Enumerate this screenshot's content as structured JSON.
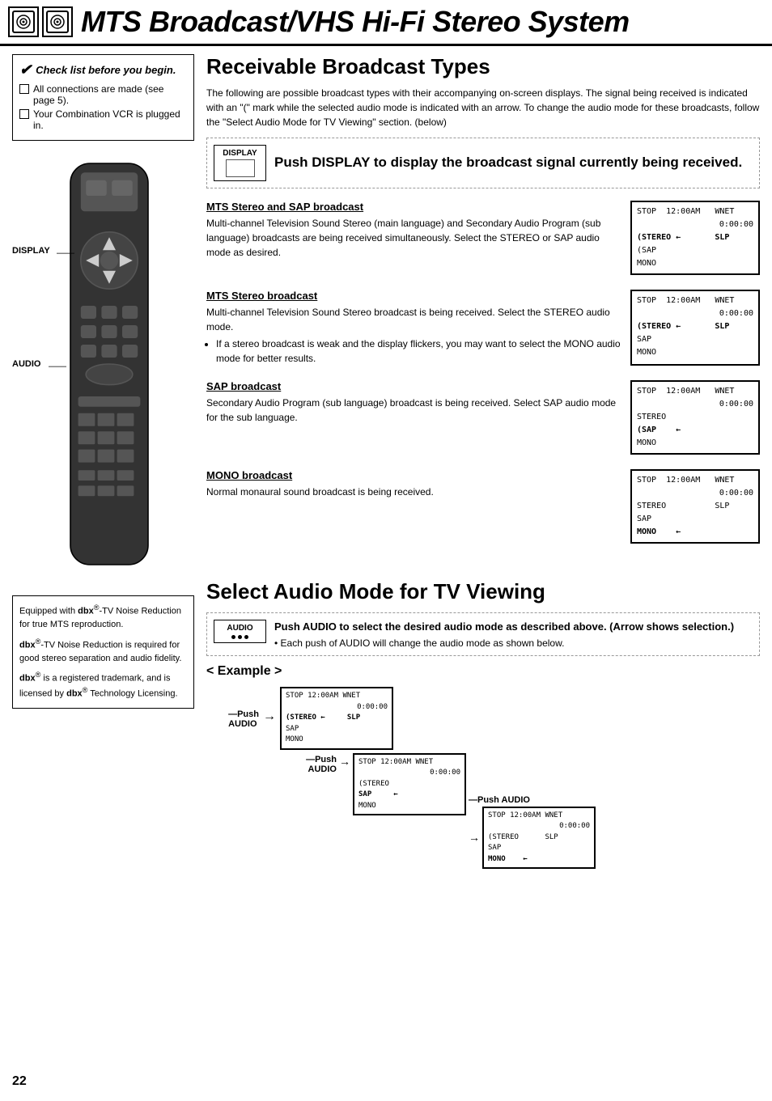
{
  "header": {
    "title": "MTS Broadcast/VHS Hi-Fi Stereo System"
  },
  "checklist": {
    "title": "Check list before you begin.",
    "items": [
      "All connections are made (see page 5).",
      "Your Combination VCR is plugged in."
    ]
  },
  "receivable_broadcast": {
    "title": "Receivable Broadcast Types",
    "intro": "The following are possible broadcast types with their accompanying on-screen displays. The signal being received is indicated with an \"(\" mark while the selected audio mode is indicated with an arrow. To change the audio mode for these broadcasts, follow the \"Select Audio Mode for TV Viewing\" section. (below)",
    "push_display_text": "Push DISPLAY to display the broadcast signal currently being received.",
    "display_label": "DISPLAY",
    "broadcasts": [
      {
        "heading": "MTS Stereo and SAP broadcast",
        "description": "Multi-channel Television Sound Stereo (main language) and Secondary Audio Program (sub language) broadcasts are being received simultaneously. Select the STEREO or SAP audio mode as desired.",
        "screen_lines": [
          "STOP  12:00AM      WNET",
          "                 0:00:00",
          "(STEREO ←              SLP",
          "(SAP",
          "MONO"
        ]
      },
      {
        "heading": "MTS Stereo broadcast",
        "description": "Multi-channel Television Sound Stereo broadcast is being received. Select the STEREO audio mode.",
        "bullet": "If a stereo broadcast is weak and the display flickers, you may want to select the MONO audio mode for better results.",
        "screen_lines": [
          "STOP  12:00AM      WNET",
          "                 0:00:00",
          "(STEREO ←              SLP",
          "SAP",
          "MONO"
        ]
      },
      {
        "heading": "SAP broadcast",
        "description": "Secondary Audio Program (sub language) broadcast is being received. Select SAP audio mode for the sub language.",
        "screen_lines": [
          "STOP  12:00AM      WNET",
          "                 0:00:00",
          "STEREO",
          "(SAP   ←",
          "MONO"
        ]
      },
      {
        "heading": "MONO broadcast",
        "description": "Normal monaural sound broadcast is being received.",
        "screen_lines": [
          "STOP  12:00AM      WNET",
          "                 0:00:00",
          "STEREO                 SLP",
          "SAP",
          "MONO   ←"
        ]
      }
    ]
  },
  "select_audio": {
    "title": "Select Audio Mode for TV Viewing",
    "audio_label": "AUDIO",
    "push_desc": "Push AUDIO to select the desired audio mode as described above. (Arrow shows selection.)",
    "push_sub": "Each push of AUDIO will change the audio mode as shown below.",
    "example_title": "< Example >",
    "example_screens": [
      {
        "lines": [
          "STOP  12:00AM    WNET",
          "               0:00:00",
          "(STEREO ←          SLP",
          "SAP",
          "MONO"
        ],
        "push_label": "Push AUDIO"
      },
      {
        "lines": [
          "STOP  12:00AM    WNET",
          "               0:00:00",
          "(STEREO",
          "SAP     ←",
          "MONO"
        ],
        "push_label": "Push AUDIO"
      },
      {
        "lines": [
          "STOP  12:00AM    WNET",
          "               0:00:00",
          "(STEREO            SLP",
          "SAP",
          "MONO   ←"
        ]
      }
    ]
  },
  "dbx_box": {
    "lines": [
      "Equipped with dbx®-TV Noise Reduction for true MTS reproduction.",
      "dbx®-TV Noise Reduction is required for good stereo separation and audio fidelity.",
      "dbx® is a registered trademark, and is licensed by dbx®Technology Licensing."
    ]
  },
  "labels": {
    "display_side": "DISPLAY",
    "audio_side": "AUDIO",
    "push_audio": "Push\nAUDIO",
    "push_audio_label": "—Push\n  AUDIO"
  },
  "page_number": "22"
}
